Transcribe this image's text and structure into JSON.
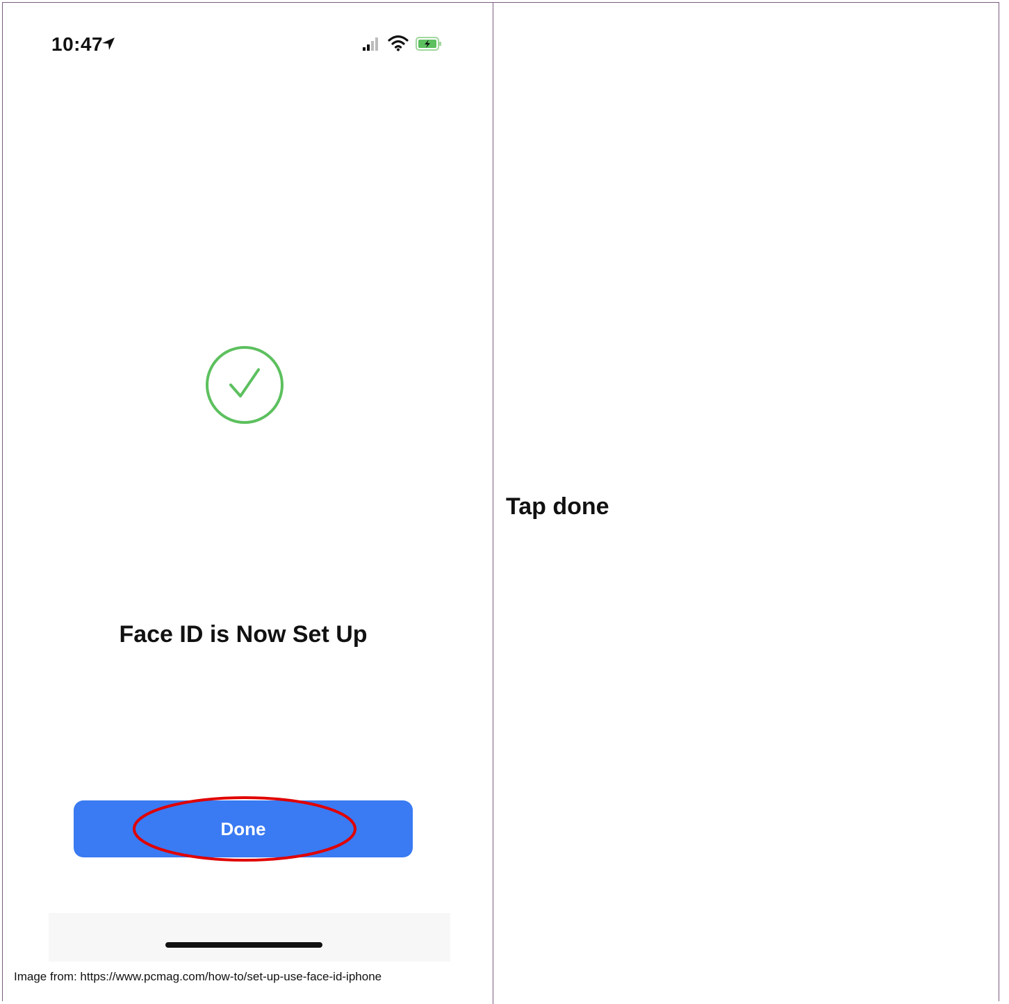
{
  "phone": {
    "status_time": "10:47",
    "location_icon": "location-arrow-icon",
    "signal_icon": "cellular-signal-icon",
    "wifi_icon": "wifi-icon",
    "battery_icon": "battery-charging-icon",
    "success_icon": "checkmark-circle-icon",
    "success_color": "#5cc05e",
    "title": "Face ID is Now Set Up",
    "done_label": "Done",
    "button_color": "#3a7af2",
    "highlight_color": "#e00000"
  },
  "caption": "Image from: https://www.pcmag.com/how-to/set-up-use-face-id-iphone",
  "instruction": "Tap done"
}
